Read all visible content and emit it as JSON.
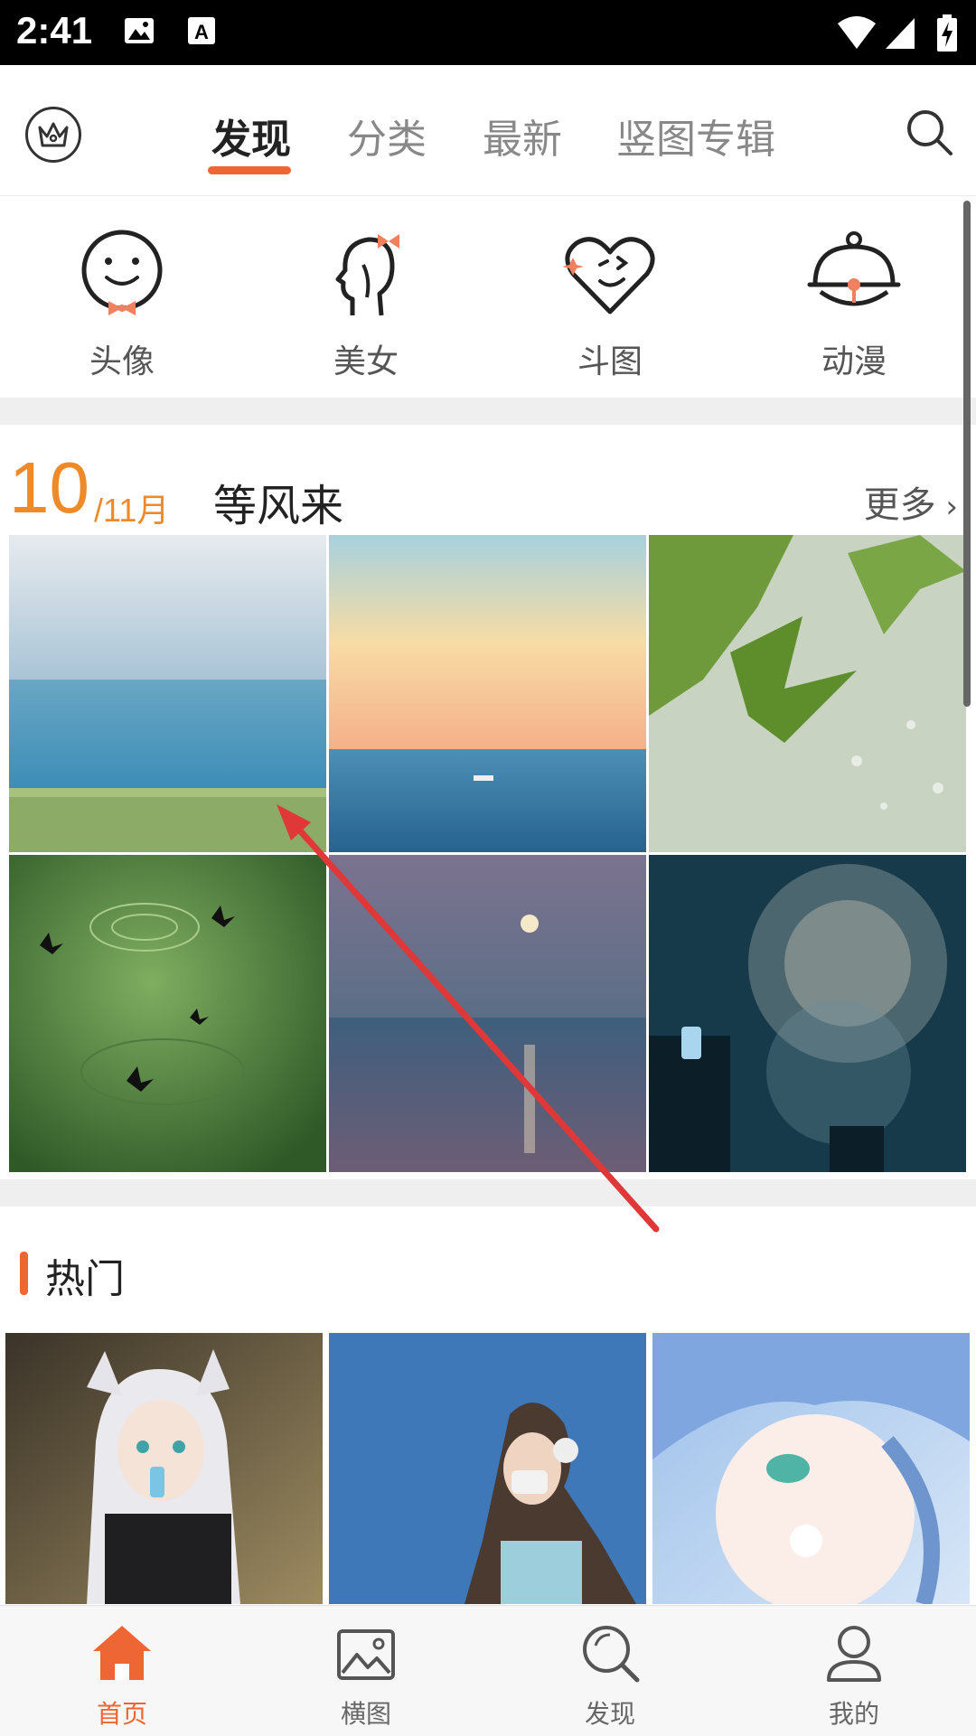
{
  "status_bar": {
    "time": "2:41"
  },
  "top_tabs": [
    {
      "label": "发现",
      "active": true
    },
    {
      "label": "分类",
      "active": false
    },
    {
      "label": "最新",
      "active": false
    },
    {
      "label": "竖图专辑",
      "active": false
    }
  ],
  "categories": [
    {
      "label": "头像",
      "icon": "smiley-bowtie-icon"
    },
    {
      "label": "美女",
      "icon": "woman-profile-bow-icon"
    },
    {
      "label": "斗图",
      "icon": "heart-wink-icon"
    },
    {
      "label": "动漫",
      "icon": "bell-icon"
    }
  ],
  "featured": {
    "day": "10",
    "month": "/11月",
    "title": "等风来",
    "more": "更多"
  },
  "hot": {
    "title": "热门"
  },
  "bottom_nav": [
    {
      "label": "首页",
      "icon": "home-icon",
      "active": true
    },
    {
      "label": "横图",
      "icon": "image-icon",
      "active": false
    },
    {
      "label": "发现",
      "icon": "search-icon",
      "active": false
    },
    {
      "label": "我的",
      "icon": "user-icon",
      "active": false
    }
  ],
  "colors": {
    "accent": "#ee6633",
    "date": "#ef8a2a"
  }
}
